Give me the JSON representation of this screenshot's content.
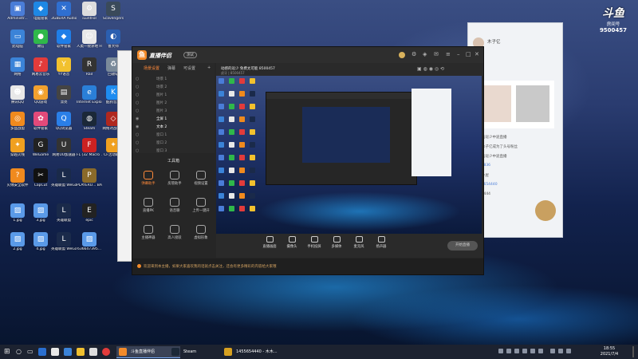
{
  "desktop": {
    "icons": [
      {
        "label": "Administr...",
        "color": "#4a7dd8",
        "glyph": "▣"
      },
      {
        "label": "电脑管家",
        "color": "#1e88e5",
        "glyph": "◆"
      },
      {
        "label": "3GBERA Audio ...",
        "color": "#2f6fd0",
        "glyph": "✕"
      },
      {
        "label": "iLuntFol",
        "color": "#dddddd",
        "glyph": "⚙"
      },
      {
        "label": "Scavengers",
        "color": "#3a4a5a",
        "glyph": "S"
      },
      {
        "label": "此电脑",
        "color": "#3b83d8",
        "glyph": "▭"
      },
      {
        "label": "微信",
        "color": "#2fb84a",
        "glyph": "●"
      },
      {
        "label": "软件管家",
        "color": "#1f7ee8",
        "glyph": "◆"
      },
      {
        "label": "人类一败涂地 Human Fal...",
        "color": "#e8e8e8",
        "glyph": "☺"
      },
      {
        "label": "鲁大师",
        "color": "#2b5fb0",
        "glyph": "◐"
      },
      {
        "label": "网络",
        "color": "#3b83d8",
        "glyph": "▦"
      },
      {
        "label": "网易云音乐",
        "color": "#e23b3b",
        "glyph": "♪"
      },
      {
        "label": "YY语音",
        "color": "#f2c12e",
        "glyph": "Y"
      },
      {
        "label": "Rail",
        "color": "#333333",
        "glyph": "R"
      },
      {
        "label": "回收站",
        "color": "#7a8a9a",
        "glyph": "♻"
      },
      {
        "label": "腾讯QQ",
        "color": "#e8e8e8",
        "glyph": "☻"
      },
      {
        "label": "QQ游戏",
        "color": "#f2a12e",
        "glyph": "◉"
      },
      {
        "label": "漂亮",
        "color": "#444444",
        "glyph": "▤"
      },
      {
        "label": "Internet Explorer",
        "color": "#2a7fd8",
        "glyph": "e"
      },
      {
        "label": "酷狗音乐",
        "color": "#1e8cf0",
        "glyph": "K"
      },
      {
        "label": "多益战盟",
        "color": "#f08a1e",
        "glyph": "◎"
      },
      {
        "label": "软件管家",
        "color": "#e24a7a",
        "glyph": "✿"
      },
      {
        "label": "QQ浏览器",
        "color": "#2a7fe8",
        "glyph": "Q"
      },
      {
        "label": "Steam",
        "color": "#1b2838",
        "glyph": "◍"
      },
      {
        "label": "网络对战平台",
        "color": "#b0281f",
        "glyph": "◇"
      },
      {
        "label": "穿越火线",
        "color": "#f0a020",
        "glyph": "✦"
      },
      {
        "label": "WeGame",
        "color": "#222222",
        "glyph": "G"
      },
      {
        "label": "网易UU加速器",
        "color": "#333333",
        "glyph": "U"
      },
      {
        "label": "FL (32 Macro ...",
        "color": "#cc2222",
        "glyph": "F"
      },
      {
        "label": "CF活动助手",
        "color": "#f0a020",
        "glyph": "✦"
      },
      {
        "label": "火绒安全软件",
        "color": "#f08a1e",
        "glyph": "?"
      },
      {
        "label": "CapCut",
        "color": "#111111",
        "glyph": "✂"
      },
      {
        "label": "英雄联盟 WeGame版",
        "color": "#1a2a4a",
        "glyph": "L"
      },
      {
        "label": "PLAYERU... BATTLEGR...",
        "color": "#8a6a2a",
        "glyph": "P"
      },
      {
        "label": "1.jpg",
        "color": "#5a9ae8",
        "glyph": "▨"
      },
      {
        "label": "3.jpg",
        "color": "#5a9ae8",
        "glyph": "▨"
      },
      {
        "label": "英雄联盟",
        "color": "#1a2a4a",
        "glyph": "L"
      },
      {
        "label": "epic",
        "color": "#222222",
        "glyph": "E"
      },
      {
        "label": "2.jpg",
        "color": "#5a9ae8",
        "glyph": "▨"
      },
      {
        "label": "4.jpg",
        "color": "#5a9ae8",
        "glyph": "▨"
      },
      {
        "label": "英雄联盟 WeGame版",
        "color": "#1a2a4a",
        "glyph": "L"
      },
      {
        "label": "636647395...",
        "color": "#5a9ae8",
        "glyph": "▨"
      }
    ]
  },
  "overlay_logo": {
    "brand": "斗鱼",
    "room_label": "房间号",
    "room_number": "9500457"
  },
  "main_window": {
    "app_name": "直播伴侣",
    "version_badge": "测试",
    "tabs": [
      "场景设置",
      "弹幕",
      "可设置"
    ],
    "scene_items": [
      {
        "name": "场景 1",
        "on": false
      },
      {
        "name": "场景 2",
        "on": false
      },
      {
        "name": "图片 1",
        "on": false
      },
      {
        "name": "图片 2",
        "on": false
      },
      {
        "name": "图片 3",
        "on": false
      },
      {
        "name": "全屏 1",
        "on": true
      },
      {
        "name": "文本 2",
        "on": true
      },
      {
        "name": "窗口 1",
        "on": false
      },
      {
        "name": "窗口 2",
        "on": false
      },
      {
        "name": "窗口 3",
        "on": false
      }
    ],
    "tools_title": "工具箱",
    "tools": [
      {
        "label": "弹幕助手",
        "hot": true
      },
      {
        "label": "房管助手",
        "hot": false
      },
      {
        "label": "视频设置",
        "hot": false
      },
      {
        "label": "直播PK",
        "hot": false
      },
      {
        "label": "语音聊",
        "hot": false
      },
      {
        "label": "上传一键开",
        "hot": false
      },
      {
        "label": "主播神器",
        "hot": false
      },
      {
        "label": "高人接驳",
        "hot": false
      },
      {
        "label": "虚拟形象",
        "hot": false
      }
    ],
    "stream_title": "动感的逗少 免费太可能 8500457",
    "stream_meta": "虎牙 | 8500457",
    "bottom_tools": [
      "直播画面",
      "摄像头",
      "手机投屏",
      "多媒体",
      "麦克风",
      "扬声器"
    ],
    "start_label": "开始直播",
    "status_text": "欢迎来到本主播，如果大家喜欢我的话就点击关注，还会有更多精彩的内容给大家哦"
  },
  "chat_window": {
    "user_name": "木子亿",
    "lines": [
      "动感的逗少中途直播",
      "恭喜木子亿成为了头号粉丝",
      "动感的逗少中途直播",
      "3274836",
      "木木小屋",
      "1455654440",
      "7854444"
    ]
  },
  "taskbar": {
    "apps": [
      {
        "label": "斗鱼直播伴侣",
        "color": "#f38b2a",
        "active": true
      },
      {
        "label": "Steam",
        "color": "#1b2838",
        "active": false
      },
      {
        "label": "1455654440 - 木木...",
        "color": "#d6a020",
        "active": false
      }
    ],
    "time": "18:55",
    "date": "2021/7/4"
  }
}
